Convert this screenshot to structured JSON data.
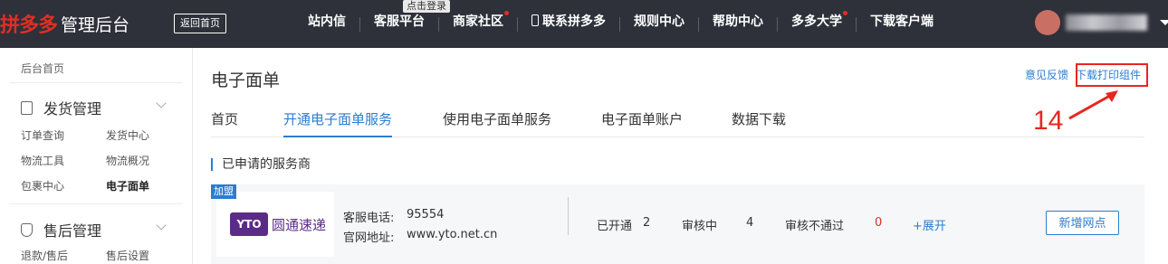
{
  "header": {
    "brand": "拼多多",
    "title": "管理后台",
    "back_home": "返回首页",
    "tooltip": "点击登录",
    "nav": [
      {
        "label": "站内信"
      },
      {
        "label": "客服平台"
      },
      {
        "label": "商家社区"
      },
      {
        "label": "联系拼多多"
      },
      {
        "label": "规则中心"
      },
      {
        "label": "帮助中心"
      },
      {
        "label": "多多大学"
      },
      {
        "label": "下载客户端"
      }
    ]
  },
  "sidebar": {
    "home": "后台首页",
    "groups": [
      {
        "label": "发货管理",
        "links": [
          "订单查询",
          "发货中心",
          "物流工具",
          "物流概况",
          "包裹中心",
          "电子面单"
        ]
      },
      {
        "label": "售后管理",
        "links": [
          "退款/售后",
          "售后设置"
        ]
      }
    ],
    "active_link": "电子面单"
  },
  "main": {
    "title": "电子面单",
    "feedback": "意见反馈",
    "download_component": "下载打印组件",
    "annotation_number": "14",
    "tabs": [
      {
        "label": "首页"
      },
      {
        "label": "开通电子面单服务"
      },
      {
        "label": "使用电子面单服务"
      },
      {
        "label": "电子面单账户"
      },
      {
        "label": "数据下载"
      }
    ],
    "active_tab": "开通电子面单服务",
    "section_title": "已申请的服务商",
    "provider": {
      "badge": "加盟",
      "logo_mark": "YTO",
      "logo_name": "圆通速递",
      "phone_label": "客服电话:",
      "phone": "95554",
      "site_label": "官网地址:",
      "site": "www.yto.net.cn",
      "opened_label": "已开通",
      "opened": "2",
      "reviewing_label": "审核中",
      "reviewing": "4",
      "rejected_label": "审核不通过",
      "rejected": "0",
      "expand": "+展开",
      "add_button": "新增网点"
    }
  },
  "colors": {
    "topbar": "#2e303a",
    "brand_red": "#e02e24",
    "link_blue": "#2b7dd0",
    "annotation_red": "#e8261f"
  }
}
